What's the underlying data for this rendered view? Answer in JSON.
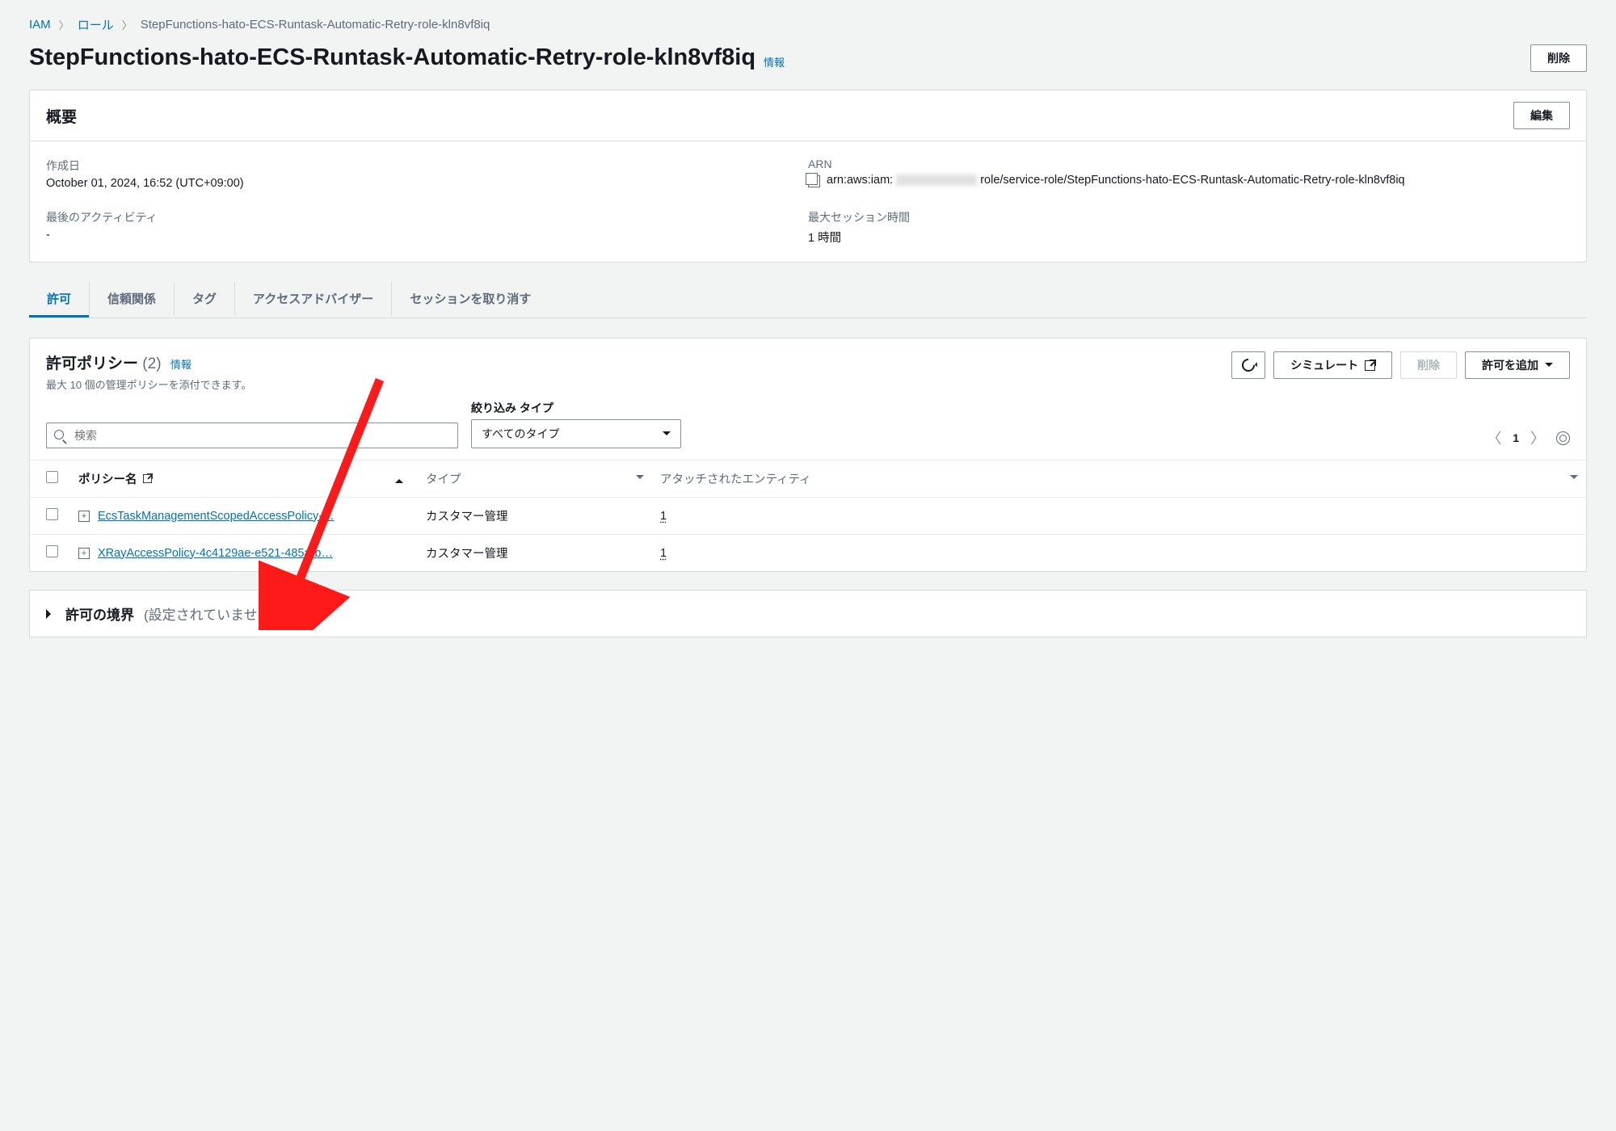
{
  "breadcrumb": {
    "root": "IAM",
    "roles": "ロール",
    "current": "StepFunctions-hato-ECS-Runtask-Automatic-Retry-role-kln8vf8iq"
  },
  "page_title": "StepFunctions-hato-ECS-Runtask-Automatic-Retry-role-kln8vf8iq",
  "info_link": "情報",
  "buttons": {
    "delete": "削除",
    "edit": "編集",
    "refresh": "",
    "simulate": "シミュレート",
    "delete_policy": "削除",
    "add_permission": "許可を追加"
  },
  "summary": {
    "heading": "概要",
    "created_label": "作成日",
    "created_value": "October 01, 2024, 16:52 (UTC+09:00)",
    "arn_label": "ARN",
    "arn_prefix": "arn:aws:iam:",
    "arn_suffix": "role/service-role/StepFunctions-hato-ECS-Runtask-Automatic-Retry-role-kln8vf8iq",
    "last_activity_label": "最後のアクティビティ",
    "last_activity_value": "-",
    "max_session_label": "最大セッション時間",
    "max_session_value": "1 時間"
  },
  "tabs": {
    "items": [
      "許可",
      "信頼関係",
      "タグ",
      "アクセスアドバイザー",
      "セッションを取り消す"
    ],
    "active_index": 0
  },
  "policies": {
    "heading": "許可ポリシー",
    "count": "(2)",
    "info": "情報",
    "subtitle": "最大 10 個の管理ポリシーを添付できます。",
    "search_placeholder": "検索",
    "filter_label": "絞り込み タイプ",
    "filter_value": "すべてのタイプ",
    "page_number": "1",
    "columns": {
      "name": "ポリシー名",
      "type": "タイプ",
      "attached": "アタッチされたエンティティ"
    },
    "rows": [
      {
        "name": "EcsTaskManagementScopedAccessPolicy-…",
        "type": "カスタマー管理",
        "attached": "1"
      },
      {
        "name": "XRayAccessPolicy-4c4129ae-e521-485a-b…",
        "type": "カスタマー管理",
        "attached": "1"
      }
    ]
  },
  "boundary": {
    "title": "許可の境界",
    "status": "(設定されていません)"
  }
}
